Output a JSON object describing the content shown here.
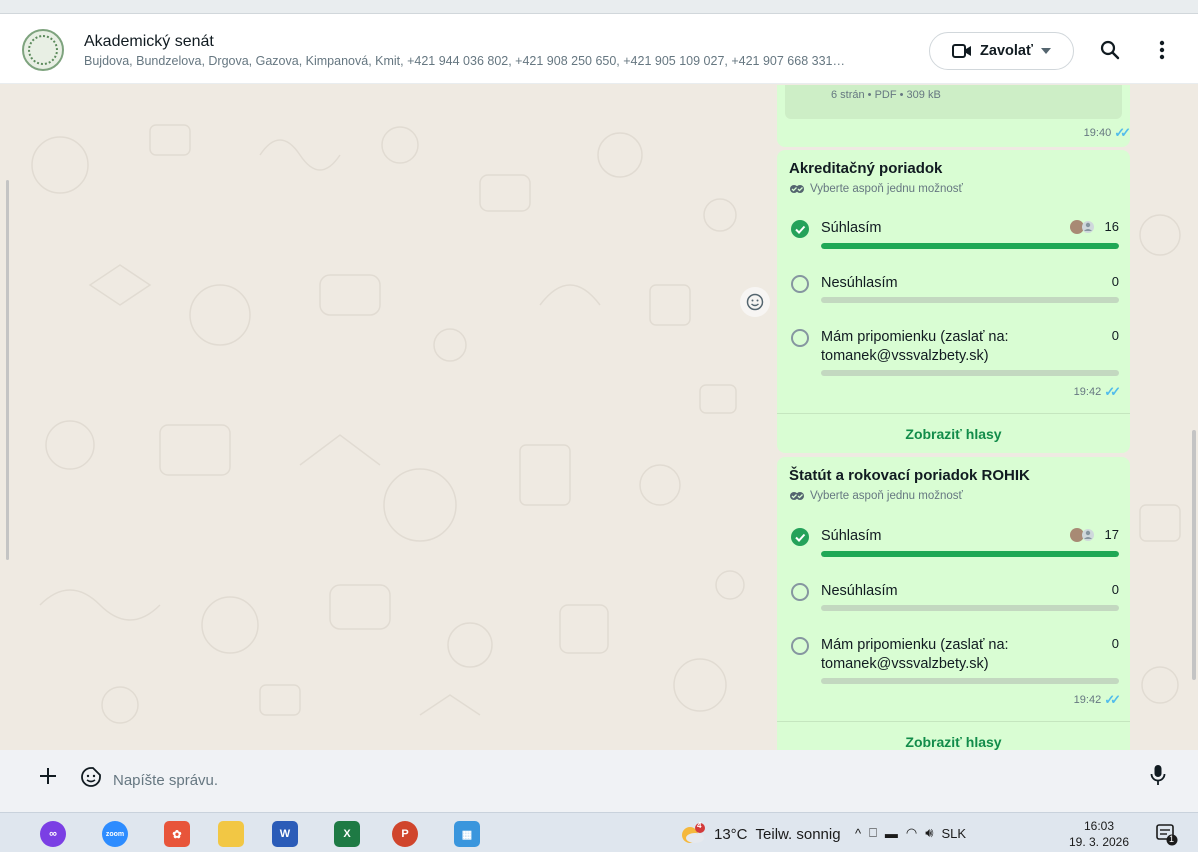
{
  "header": {
    "title": "Akademický senát",
    "subtitle": "Bujdova, Bundzelova, Drgova, Gazova, Kimpanová, Kmit, +421 944 036 802, +421 908 250 650, +421 905 109 027, +421 907 668 331…",
    "call_label": "Zavolať"
  },
  "document_message": {
    "meta": "6 strán • PDF • 309 kB",
    "time": "19:40"
  },
  "polls": [
    {
      "title": "Akreditačný poriadok",
      "hint": "Vyberte aspoň jednu možnosť",
      "time": "19:42",
      "view_votes": "Zobraziť hlasy",
      "options": [
        {
          "label": "Súhlasím",
          "count": "16",
          "fill": 1.0,
          "checked": true
        },
        {
          "label": "Nesúhlasím",
          "count": "0",
          "fill": 0,
          "checked": false
        },
        {
          "label": "Mám pripomienku (zaslať na: tomanek@vssvalzbety.sk)",
          "count": "0",
          "fill": 0,
          "checked": false
        }
      ]
    },
    {
      "title": "Štatút a rokovací poriadok ROHIK",
      "hint": "Vyberte aspoň jednu možnosť",
      "time": "19:42",
      "view_votes": "Zobraziť hlasy",
      "options": [
        {
          "label": "Súhlasím",
          "count": "17",
          "fill": 1.0,
          "checked": true
        },
        {
          "label": "Nesúhlasím",
          "count": "0",
          "fill": 0,
          "checked": false
        },
        {
          "label": "Mám pripomienku (zaslať na: tomanek@vssvalzbety.sk)",
          "count": "0",
          "fill": 0,
          "checked": false
        }
      ]
    }
  ],
  "input": {
    "placeholder": "Napíšte správu."
  },
  "taskbar": {
    "weather_temp": "13°C",
    "weather_text": "Teilw. sonnig",
    "weather_badge": "4",
    "language": "SLK",
    "time": "16:03",
    "date": "19. 3. 2026",
    "notification_count": "1"
  },
  "colors": {
    "bubble": "#d9fdd3",
    "accent_green": "#1fa855",
    "read_ticks": "#53bdeb"
  }
}
